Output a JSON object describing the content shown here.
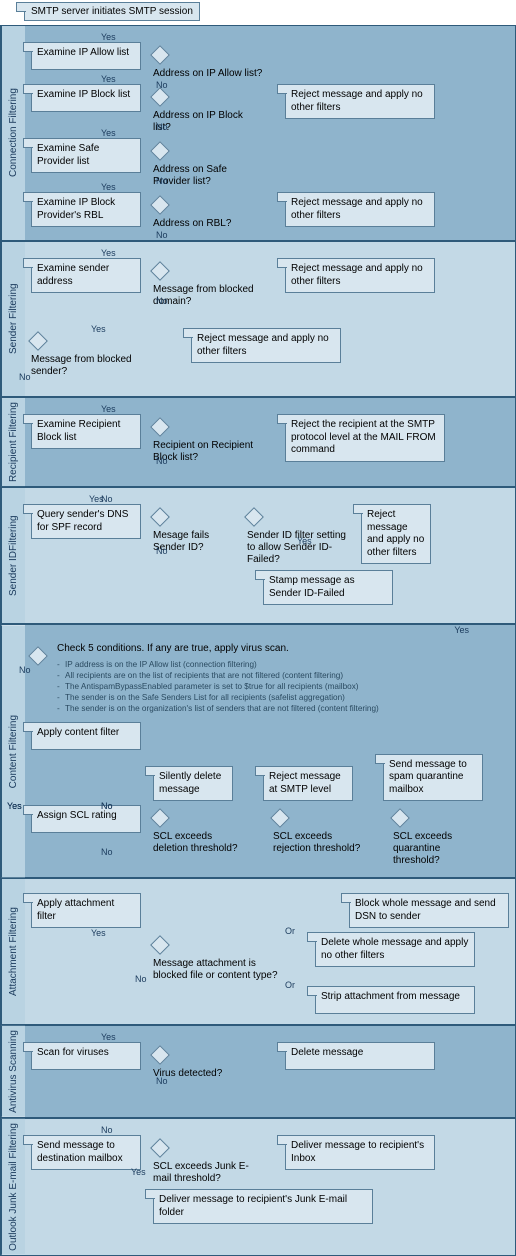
{
  "start": "SMTP server initiates SMTP session",
  "labels": {
    "yes": "Yes",
    "no": "No",
    "or": "Or"
  },
  "conn": {
    "title": "Connection Filtering",
    "r1": {
      "step": "Examine IP Allow list",
      "q": "Address on IP Allow list?"
    },
    "r2": {
      "step": "Examine IP Block list",
      "q": "Address on IP Block list?",
      "out": "Reject message and apply no other filters"
    },
    "r3": {
      "step": "Examine Safe Provider list",
      "q": "Address on Safe Provider list?"
    },
    "r4": {
      "step": "Examine IP Block Provider's RBL",
      "q": "Address on RBL?",
      "out": "Reject message and apply no other filters"
    }
  },
  "sender": {
    "title": "Sender Filtering",
    "r1": {
      "step": "Examine sender address",
      "q": "Message from blocked domain?",
      "out": "Reject message and apply no other filters"
    },
    "r2": {
      "q": "Message from blocked sender?",
      "out": "Reject message and apply no other filters"
    }
  },
  "recip": {
    "title": "Recipient Filtering",
    "r1": {
      "step": "Examine Recipient Block list",
      "q": "Recipient on Recipient Block list?",
      "out": "Reject the recipient at the SMTP protocol level at the MAIL FROM command"
    }
  },
  "sid": {
    "title": "Sender IDFiltering",
    "r1": {
      "step": "Query sender's DNS for SPF record",
      "q": "Mesage fails Sender ID?",
      "q2": "Sender ID filter setting to allow Sender ID-Failed?",
      "out": "Reject message and apply no other filters",
      "stamp": "Stamp message as Sender ID-Failed"
    }
  },
  "cf": {
    "title": "Content Filtering",
    "cond": {
      "head": "Check 5 conditions. If any are true, apply virus scan.",
      "items": [
        "IP address is on the IP Allow list (connection filtering)",
        "All recipients are on the list of recipients that are not filtered (content filtering)",
        "The AntispamBypassEnabled parameter is set to $true for all recipients (mailbox)",
        "The sender is on the Safe Senders List for all recipients (safelist aggregation)",
        "The sender is on the organization's list of senders that are not filtered (content filtering)"
      ]
    },
    "apply": "Apply content filter",
    "scl": "Assign SCL rating",
    "o1": "Silently delete message",
    "o2": "Reject message at SMTP level",
    "o3": "Send message to spam quarantine mailbox",
    "q1": "SCL exceeds deletion threshold?",
    "q2": "SCL exceeds rejection threshold?",
    "q3": "SCL exceeds quarantine threshold?"
  },
  "af": {
    "title": "Attachment Filtering",
    "step": "Apply attachment filter",
    "q": "Message attachment is blocked file or content  type?",
    "o1": "Block whole message and send DSN to sender",
    "o2": "Delete whole message and apply no other filters",
    "o3": "Strip attachment from message"
  },
  "av": {
    "title": "Antivirus Scanning",
    "step": "Scan for viruses",
    "q": "Virus detected?",
    "out": "Delete message"
  },
  "oj": {
    "title": "Outlook Junk E-mail Filtering",
    "step": "Send message to destination mailbox",
    "q": "SCL exceeds Junk E-mail threshold?",
    "o1": "Deliver message to recipient's Inbox",
    "o2": "Deliver message to recipient's Junk E-mail folder"
  }
}
